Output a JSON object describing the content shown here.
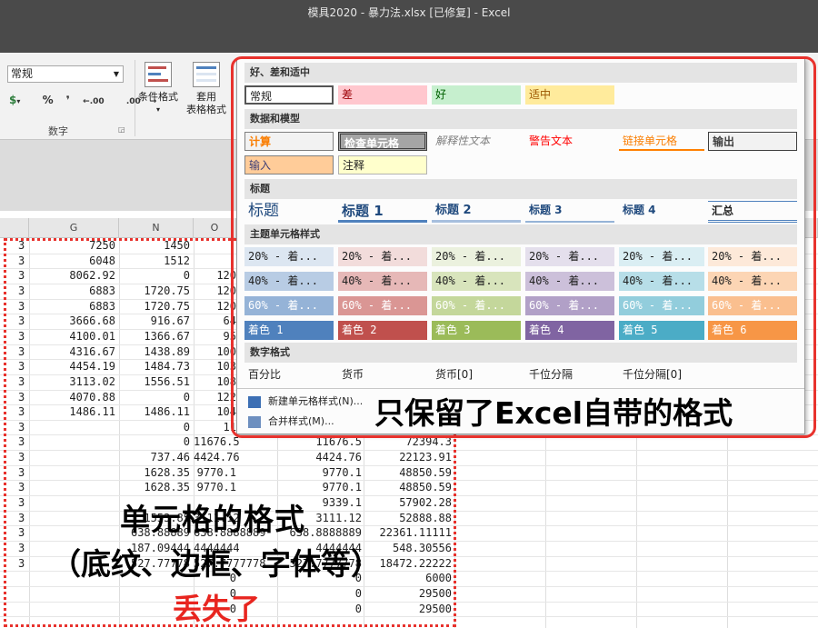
{
  "title_bar": {
    "title": "模具2020 - 暴力法.xlsx [已修复]  -  Excel"
  },
  "ribbon": {
    "number_format": "常规",
    "accounting": "▾",
    "percent": "%",
    "comma": "❜",
    "inc_dec": ".00",
    "dec_dec": ".00",
    "group_label": "数字",
    "cond_format": "条件格式",
    "table_format_1": "套用",
    "table_format_2": "表格格式"
  },
  "grid": {
    "columns": [
      "G",
      "N",
      "O"
    ],
    "rows": [
      [
        "3",
        "7250",
        "1450",
        "",
        ""
      ],
      [
        "3",
        "6048",
        "1512",
        "",
        ""
      ],
      [
        "3",
        "8062.92",
        "0",
        "120",
        ""
      ],
      [
        "3",
        "6883",
        "1720.75",
        "120",
        ""
      ],
      [
        "3",
        "6883",
        "1720.75",
        "120",
        ""
      ],
      [
        "3",
        "3666.68",
        "916.67",
        "64",
        ""
      ],
      [
        "3",
        "4100.01",
        "1366.67",
        "95",
        ""
      ],
      [
        "3",
        "4316.67",
        "1438.89",
        "100",
        ""
      ],
      [
        "3",
        "4454.19",
        "1484.73",
        "103",
        ""
      ],
      [
        "3",
        "3113.02",
        "1556.51",
        "108",
        ""
      ],
      [
        "3",
        "4070.88",
        "0",
        "122",
        ""
      ],
      [
        "3",
        "1486.11",
        "1486.11",
        "104",
        ""
      ],
      [
        "3",
        "",
        "0",
        "11",
        ""
      ],
      [
        "3",
        "",
        "0",
        "11676.5",
        "11676.5",
        "72394.3"
      ],
      [
        "3",
        "",
        "737.46",
        "4424.76",
        "4424.76",
        "22123.91"
      ],
      [
        "3",
        "",
        "1628.35",
        "9770.1",
        "9770.1",
        "48850.59"
      ],
      [
        "3",
        "",
        "1628.35",
        "9770.1",
        "9770.1",
        "48850.59"
      ],
      [
        "3",
        "",
        "",
        "",
        "9339.1",
        "57902.28"
      ],
      [
        "3",
        "",
        "1553.85",
        "3111.12",
        "3111.12",
        "52888.88"
      ],
      [
        "3",
        "",
        "638.88889",
        "638.8888889",
        "638.8888889",
        "22361.11111"
      ],
      [
        "3",
        "",
        "187.09444",
        "4444444",
        "4444444",
        "548.30556"
      ],
      [
        "3",
        "",
        "527.77778",
        "527.7777778",
        "527.7777778",
        "18472.22222"
      ],
      [
        "",
        "",
        "",
        "0",
        "0",
        "6000"
      ],
      [
        "",
        "",
        "",
        "0",
        "0",
        "29500"
      ],
      [
        "",
        "",
        "",
        "0",
        "0",
        "29500"
      ]
    ]
  },
  "gallery": {
    "sections": {
      "good_bad": "好、差和适中",
      "data_model": "数据和模型",
      "titles": "标题",
      "theme": "主题单元格样式",
      "number": "数字格式"
    },
    "good_bad": [
      "常规",
      "差",
      "好",
      "适中"
    ],
    "data_model": [
      "计算",
      "检查单元格",
      "解释性文本",
      "警告文本",
      "链接单元格",
      "输出",
      "输入",
      "注释"
    ],
    "titles": [
      "标题",
      "标题 1",
      "标题 2",
      "标题 3",
      "标题 4",
      "汇总"
    ],
    "theme20": [
      "20% - 着...",
      "20% - 着...",
      "20% - 着...",
      "20% - 着...",
      "20% - 着...",
      "20% - 着..."
    ],
    "theme40": [
      "40% - 着...",
      "40% - 着...",
      "40% - 着...",
      "40% - 着...",
      "40% - 着...",
      "40% - 着..."
    ],
    "theme60": [
      "60% - 着...",
      "60% - 着...",
      "60% - 着...",
      "60% - 着...",
      "60% - 着...",
      "60% - 着..."
    ],
    "accents": [
      "着色 1",
      "着色 2",
      "着色 3",
      "着色 4",
      "着色 5",
      "着色 6"
    ],
    "number": [
      "百分比",
      "货币",
      "货币[0]",
      "千位分隔",
      "千位分隔[0]"
    ],
    "menu": {
      "new_style": "新建单元格样式(N)...",
      "merge_style": "合并样式(M)..."
    }
  },
  "annotations": {
    "excel_only": "只保留了Excel自带的格式",
    "cell_format": "单元格的格式",
    "cell_format_detail": "（底纹、边框、字体等）",
    "lost": "丢失了"
  },
  "colors": {
    "accent_red": "#e8322d",
    "accent1": "#4f81bd",
    "accent2": "#c0504d",
    "accent3": "#9bbb59",
    "accent4": "#8064a2",
    "accent5": "#4bacc6",
    "accent6": "#f79646"
  }
}
